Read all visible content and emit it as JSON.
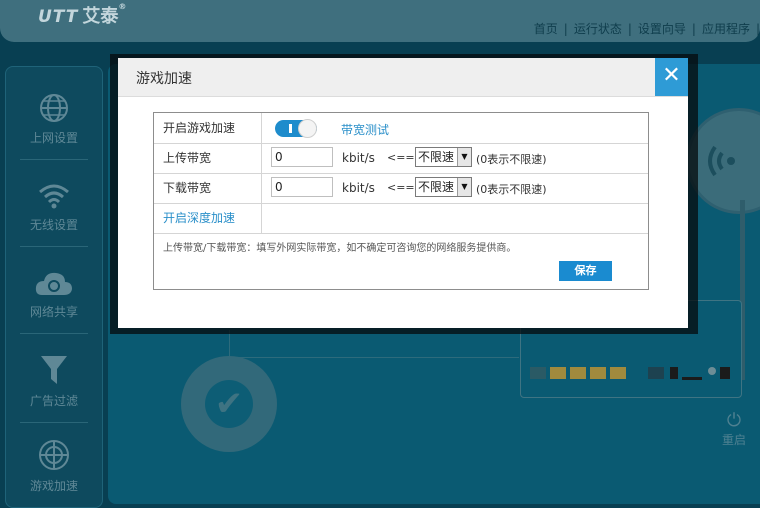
{
  "logo": {
    "mark": "UTT",
    "name": "艾泰",
    "reg": "®"
  },
  "top_nav": {
    "items": [
      "首页",
      "运行状态",
      "设置向导",
      "应用程序"
    ]
  },
  "sidebar": {
    "items": [
      {
        "label": "上网设置",
        "icon": "globe-icon"
      },
      {
        "label": "无线设置",
        "icon": "wifi-icon"
      },
      {
        "label": "网络共享",
        "icon": "cloud-share-icon"
      },
      {
        "label": "广告过滤",
        "icon": "funnel-icon"
      },
      {
        "label": "游戏加速",
        "icon": "gamepad-globe-icon"
      }
    ]
  },
  "router_panel": {
    "power_label": "重启",
    "power_icon": "power-icon"
  },
  "modal": {
    "title": "游戏加速",
    "close_icon": "close-icon",
    "enable_label": "开启游戏加速",
    "enable_state": true,
    "bandwidth_test_link": "带宽测试",
    "upload": {
      "label": "上传带宽",
      "value": "0",
      "unit": "kbit/s",
      "arrow": "<==",
      "select_value": "不限速",
      "hint": "(0表示不限速)"
    },
    "download": {
      "label": "下载带宽",
      "value": "0",
      "unit": "kbit/s",
      "arrow": "<==",
      "select_value": "不限速",
      "hint": "(0表示不限速)"
    },
    "deep_accel_link": "开启深度加速",
    "note": "上传带宽/下载带宽：填写外网实际带宽，如不确定可咨询您的网络服务提供商。",
    "save_label": "保存"
  },
  "colors": {
    "accent": "#1a8bd0",
    "background": "#083f52",
    "link": "#2a8fc9"
  }
}
